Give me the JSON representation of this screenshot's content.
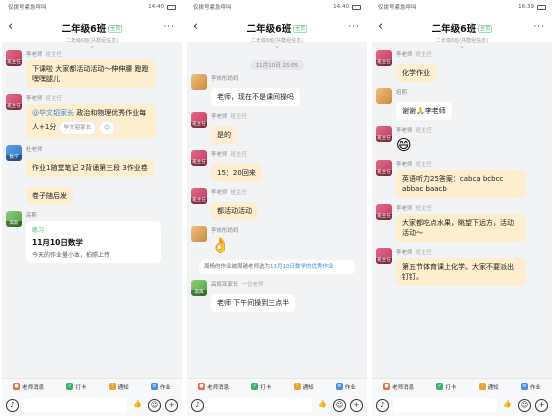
{
  "phones": [
    {
      "status": {
        "left": "仅拨号紧急呼叫",
        "right": "14:40"
      },
      "header": {
        "back": "‹",
        "title": "二年级6班",
        "tag": "全员",
        "sub": "二年级6班(共群组信息)",
        "more": "···"
      },
      "messages": [
        {
          "sender": "李老师",
          "role": "班主任",
          "avatar": "teacher",
          "avlabel": "班主任",
          "text": "下课啦 大家都活动活动～伸伸腰 蹬蹬 嘿嘿腿儿",
          "style": "yellow"
        },
        {
          "sender": "李老师",
          "role": "班主任",
          "avatar": "teacher",
          "avlabel": "班主任",
          "mention": "@毕文韬家长",
          "text": " 政治和物理优秀作业每人+1分",
          "chip1": "毕文韬家长",
          "style": "yellow"
        },
        {
          "sender": "杜老师",
          "role": "",
          "avatar": "teacher2",
          "avlabel": "数学",
          "text": "作业1随堂笔记 2背诵第三段 3作业卷",
          "style": "yellow"
        },
        {
          "sender": "",
          "role": "",
          "avatar": "",
          "avlabel": "",
          "text": "卷子随后发",
          "style": "yellow"
        }
      ],
      "card": {
        "sender": "高斯",
        "avlabel": "高斯",
        "type": "练习",
        "title": "11月10日数学",
        "desc": "今天的作业量小本，拍照上传"
      },
      "toolbar": [
        "老师消息",
        "打卡",
        "通知",
        "作业"
      ]
    },
    {
      "status": {
        "left": "仅拨号紧急呼叫",
        "right": "14:40"
      },
      "header": {
        "back": "‹",
        "title": "二年级6班",
        "tag": "全员",
        "sub": "二年级6班(共群组信息)",
        "more": "···"
      },
      "time": "11月10日 15:05",
      "messages": [
        {
          "sender": "李依彤妈妈",
          "role": "",
          "avatar": "parent",
          "avlabel": "",
          "text": "老师，现在不是课间操吗",
          "style": "white"
        },
        {
          "sender": "李老师",
          "role": "班主任",
          "avatar": "teacher",
          "avlabel": "班主任",
          "text": "是的",
          "style": "yellow"
        },
        {
          "sender": "李老师",
          "role": "班主任",
          "avatar": "teacher",
          "avlabel": "班主任",
          "text": "15：20回来",
          "style": "yellow"
        },
        {
          "sender": "李老师",
          "role": "班主任",
          "avatar": "teacher",
          "avlabel": "班主任",
          "text": "都活动活动",
          "style": "yellow"
        },
        {
          "sender": "李依彤妈妈",
          "role": "",
          "avatar": "parent",
          "avlabel": "",
          "text": "👌",
          "style": "sticker"
        }
      ],
      "notice": {
        "prefix": "周杨的作业被周越老师选为",
        "link": "11月10日数学的优秀作业",
        "suffix": ""
      },
      "last": {
        "sender": "高辉亚家长",
        "role": "一位老师",
        "avatar": "parent2",
        "avlabel": "高辉",
        "text": "老师 下午间操到三点半",
        "style": "white"
      },
      "toolbar": [
        "老师消息",
        "打卡",
        "通知",
        "作业"
      ]
    },
    {
      "status": {
        "left": "仅拨号紧急呼叫",
        "right": "16:39"
      },
      "header": {
        "back": "‹",
        "title": "二年级6班",
        "tag": "全员",
        "sub": "二年级6班(共群组信息)",
        "more": "···"
      },
      "messages": [
        {
          "sender": "李老师",
          "role": "班主任",
          "avatar": "teacher",
          "avlabel": "班主任",
          "text": "化学作业",
          "style": "yellow"
        },
        {
          "sender": "焙熙",
          "role": "",
          "avatar": "parent",
          "avlabel": "",
          "text": "谢谢🙏李老师",
          "style": "white"
        },
        {
          "sender": "李老师",
          "role": "班主任",
          "avatar": "teacher",
          "avlabel": "班主任",
          "text": "😄",
          "style": "emoji"
        },
        {
          "sender": "李老师",
          "role": "班主任",
          "avatar": "teacher",
          "avlabel": "班主任",
          "text": "英语听力25答案：cabca bcbcc abbac baacb",
          "style": "yellow"
        },
        {
          "sender": "李老师",
          "role": "班主任",
          "avatar": "teacher",
          "avlabel": "班主任",
          "text": "大家都吃点水果，眺望下远方，活动活动～",
          "style": "yellow"
        },
        {
          "sender": "李老师",
          "role": "班主任",
          "avatar": "teacher",
          "avlabel": "班主任",
          "text": "第五节体育课上化学。大家不要派出钉钉。",
          "style": "yellow"
        }
      ],
      "toolbar": [
        "老师消息",
        "打卡",
        "通知",
        "作业"
      ]
    }
  ],
  "toolbar_colors": [
    "#f06a3a",
    "#3bb56a",
    "#f0a030",
    "#4a8fe0"
  ],
  "input_icons": {
    "voice": "🎙",
    "like": "👍",
    "emoji": "☺",
    "plus": "+"
  }
}
